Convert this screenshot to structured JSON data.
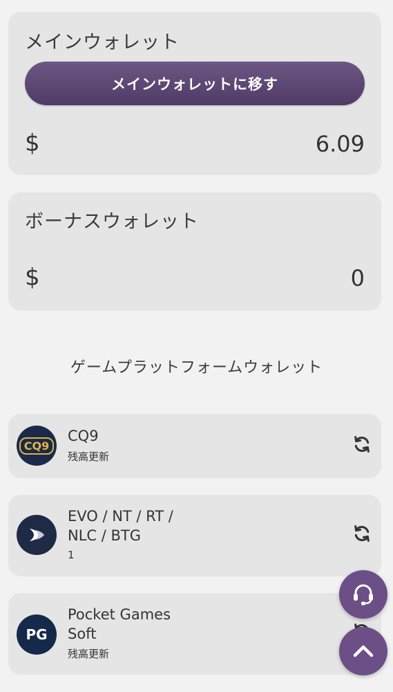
{
  "main_wallet": {
    "title": "メインウォレット",
    "transfer_button": "メインウォレットに移す",
    "currency": "$",
    "amount": "6.09"
  },
  "bonus_wallet": {
    "title": "ボーナスウォレット",
    "currency": "$",
    "amount": "0"
  },
  "platform_section_title": "ゲームプラットフォームウォレット",
  "platforms": [
    {
      "logo_text": "CQ9",
      "name_line1": "CQ9",
      "name_line2": "",
      "sub": "残高更新"
    },
    {
      "logo_text": "",
      "name_line1": "EVO / NT / RT /",
      "name_line2": "NLC / BTG",
      "sub": "1"
    },
    {
      "logo_text": "PG",
      "name_line1": "Pocket Games",
      "name_line2": "Soft",
      "sub": "残高更新"
    }
  ],
  "colors": {
    "accent": "#5e4877",
    "card": "#e5e5e6",
    "background": "#f2f2f3"
  },
  "icons": {
    "refresh": "refresh-icon",
    "support": "headset-icon",
    "scroll_top": "chevron-up-icon"
  }
}
